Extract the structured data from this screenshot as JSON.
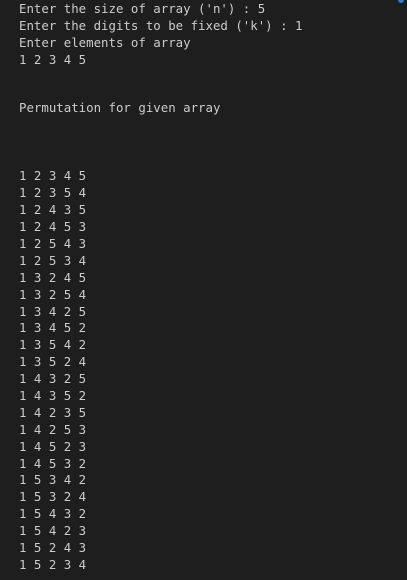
{
  "prompts": {
    "size_prompt": "Enter the size of array ('n') : 5",
    "digits_prompt": "Enter the digits to be fixed ('k') : 1",
    "elements_prompt": "Enter elements of array",
    "input_array": "1 2 3 4 5"
  },
  "heading": "Permutation for given array",
  "permutations": [
    "1 2 3 4 5",
    "1 2 3 5 4",
    "1 2 4 3 5",
    "1 2 4 5 3",
    "1 2 5 4 3",
    "1 2 5 3 4",
    "1 3 2 4 5",
    "1 3 2 5 4",
    "1 3 4 2 5",
    "1 3 4 5 2",
    "1 3 5 4 2",
    "1 3 5 2 4",
    "1 4 3 2 5",
    "1 4 3 5 2",
    "1 4 2 3 5",
    "1 4 2 5 3",
    "1 4 5 2 3",
    "1 4 5 3 2",
    "1 5 3 4 2",
    "1 5 3 2 4",
    "1 5 4 3 2",
    "1 5 4 2 3",
    "1 5 2 4 3",
    "1 5 2 3 4"
  ],
  "colors": {
    "background": "#1e1e1e",
    "text": "#cccccc",
    "accent": "#2b7fd0"
  }
}
